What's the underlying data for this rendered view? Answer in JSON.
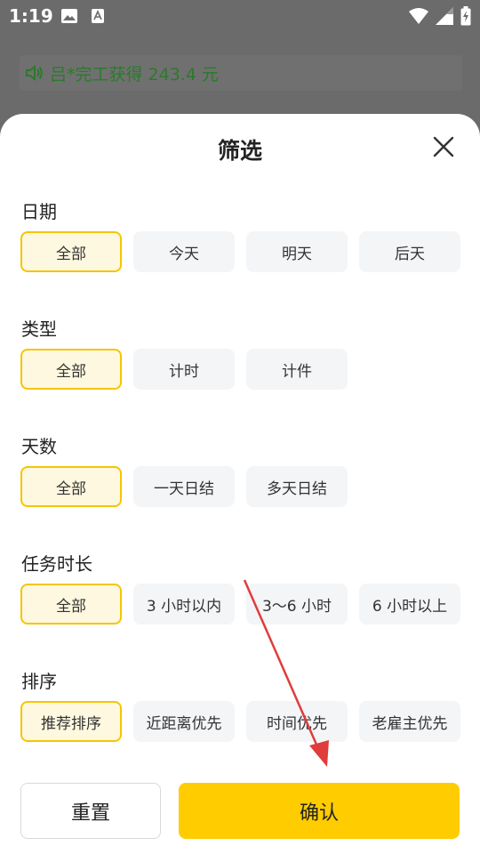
{
  "status_bar": {
    "time": "1:19",
    "icons_left": [
      "image-icon",
      "text-a-icon"
    ],
    "icons_right": [
      "wifi-icon",
      "signal-icon",
      "battery-icon"
    ]
  },
  "notice": {
    "text": "吕*完工获得 243.4 元",
    "icon": "speaker-icon",
    "color": "#2b7a2b"
  },
  "sheet": {
    "title": "筛选",
    "close_icon": "close-icon"
  },
  "sections": [
    {
      "label": "日期",
      "options": [
        "全部",
        "今天",
        "明天",
        "后天"
      ],
      "selected": 0
    },
    {
      "label": "类型",
      "options": [
        "全部",
        "计时",
        "计件"
      ],
      "selected": 0
    },
    {
      "label": "天数",
      "options": [
        "全部",
        "一天日结",
        "多天日结"
      ],
      "selected": 0
    },
    {
      "label": "任务时长",
      "options": [
        "全部",
        "3 小时以内",
        "3～6 小时",
        "6 小时以上"
      ],
      "selected": 0
    },
    {
      "label": "排序",
      "options": [
        "推荐排序",
        "近距离优先",
        "时间优先",
        "老雇主优先"
      ],
      "selected": 0
    }
  ],
  "buttons": {
    "reset": "重置",
    "confirm": "确认"
  },
  "colors": {
    "accent": "#ffcc00",
    "selected_bg": "#fff8e0",
    "selected_border": "#f6c500",
    "chip_bg": "#f4f5f7",
    "annotation_arrow": "#e03c3c"
  }
}
